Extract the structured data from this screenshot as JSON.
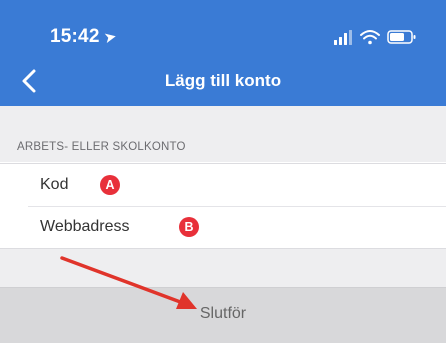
{
  "status_bar": {
    "time": "15:42",
    "location_glyph": "➤",
    "icons": [
      "signal-icon",
      "wifi-icon",
      "battery-icon"
    ]
  },
  "nav": {
    "back_icon": "chevron-left-icon",
    "title": "Lägg till konto"
  },
  "section": {
    "header": "ARBETS- ELLER SKOLKONTO",
    "rows": [
      {
        "label": "Kod",
        "badge": "A"
      },
      {
        "label": "Webbadress",
        "badge": "B"
      }
    ]
  },
  "footer": {
    "finish_label": "Slutför"
  },
  "annotations": {
    "arrow_icon": "red-arrow-icon"
  },
  "colors": {
    "accent": "#3a7bd5",
    "badge": "#e8303a",
    "arrow": "#e0342b",
    "button_bg": "#d8d8da"
  }
}
